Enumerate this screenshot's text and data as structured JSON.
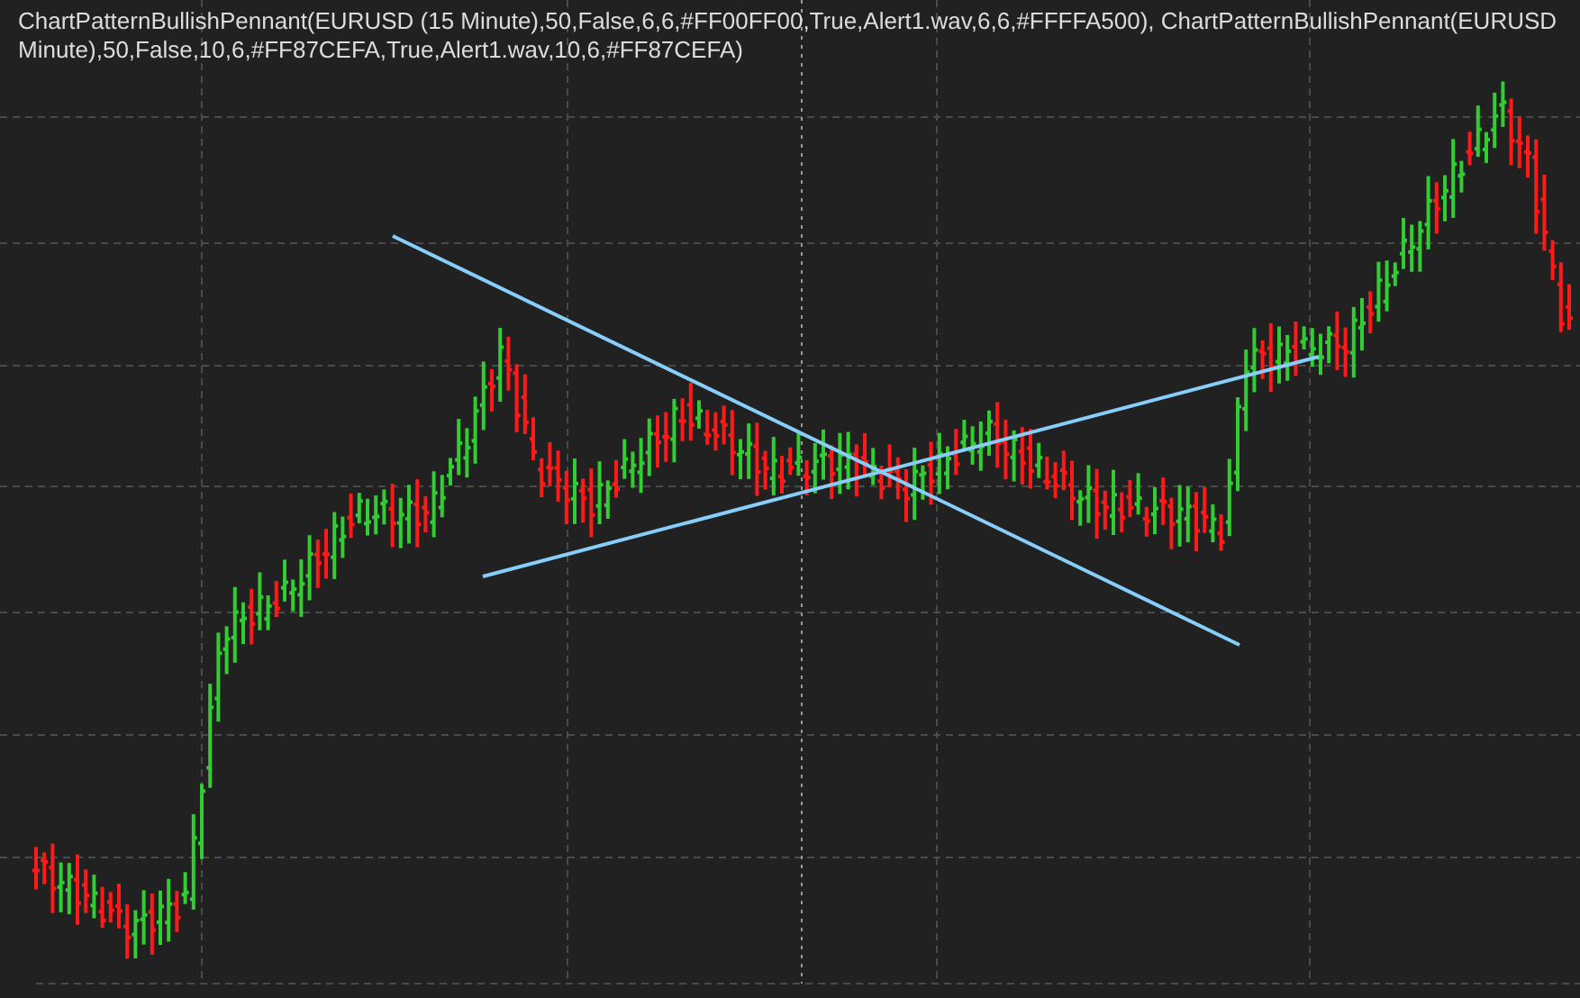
{
  "indicator_label": {
    "lines": [
      "ChartPatternBullishPennant(EURUSD (15 Minute),50,False,6,6,#FF00FF00,True,Alert1.wav,6,6,#FFFFA500), ChartPatternBullishPennant(EURUSD",
      "Minute),50,False,10,6,#FF87CEFA,True,Alert1.wav,10,6,#FF87CEFA)"
    ]
  }
}
